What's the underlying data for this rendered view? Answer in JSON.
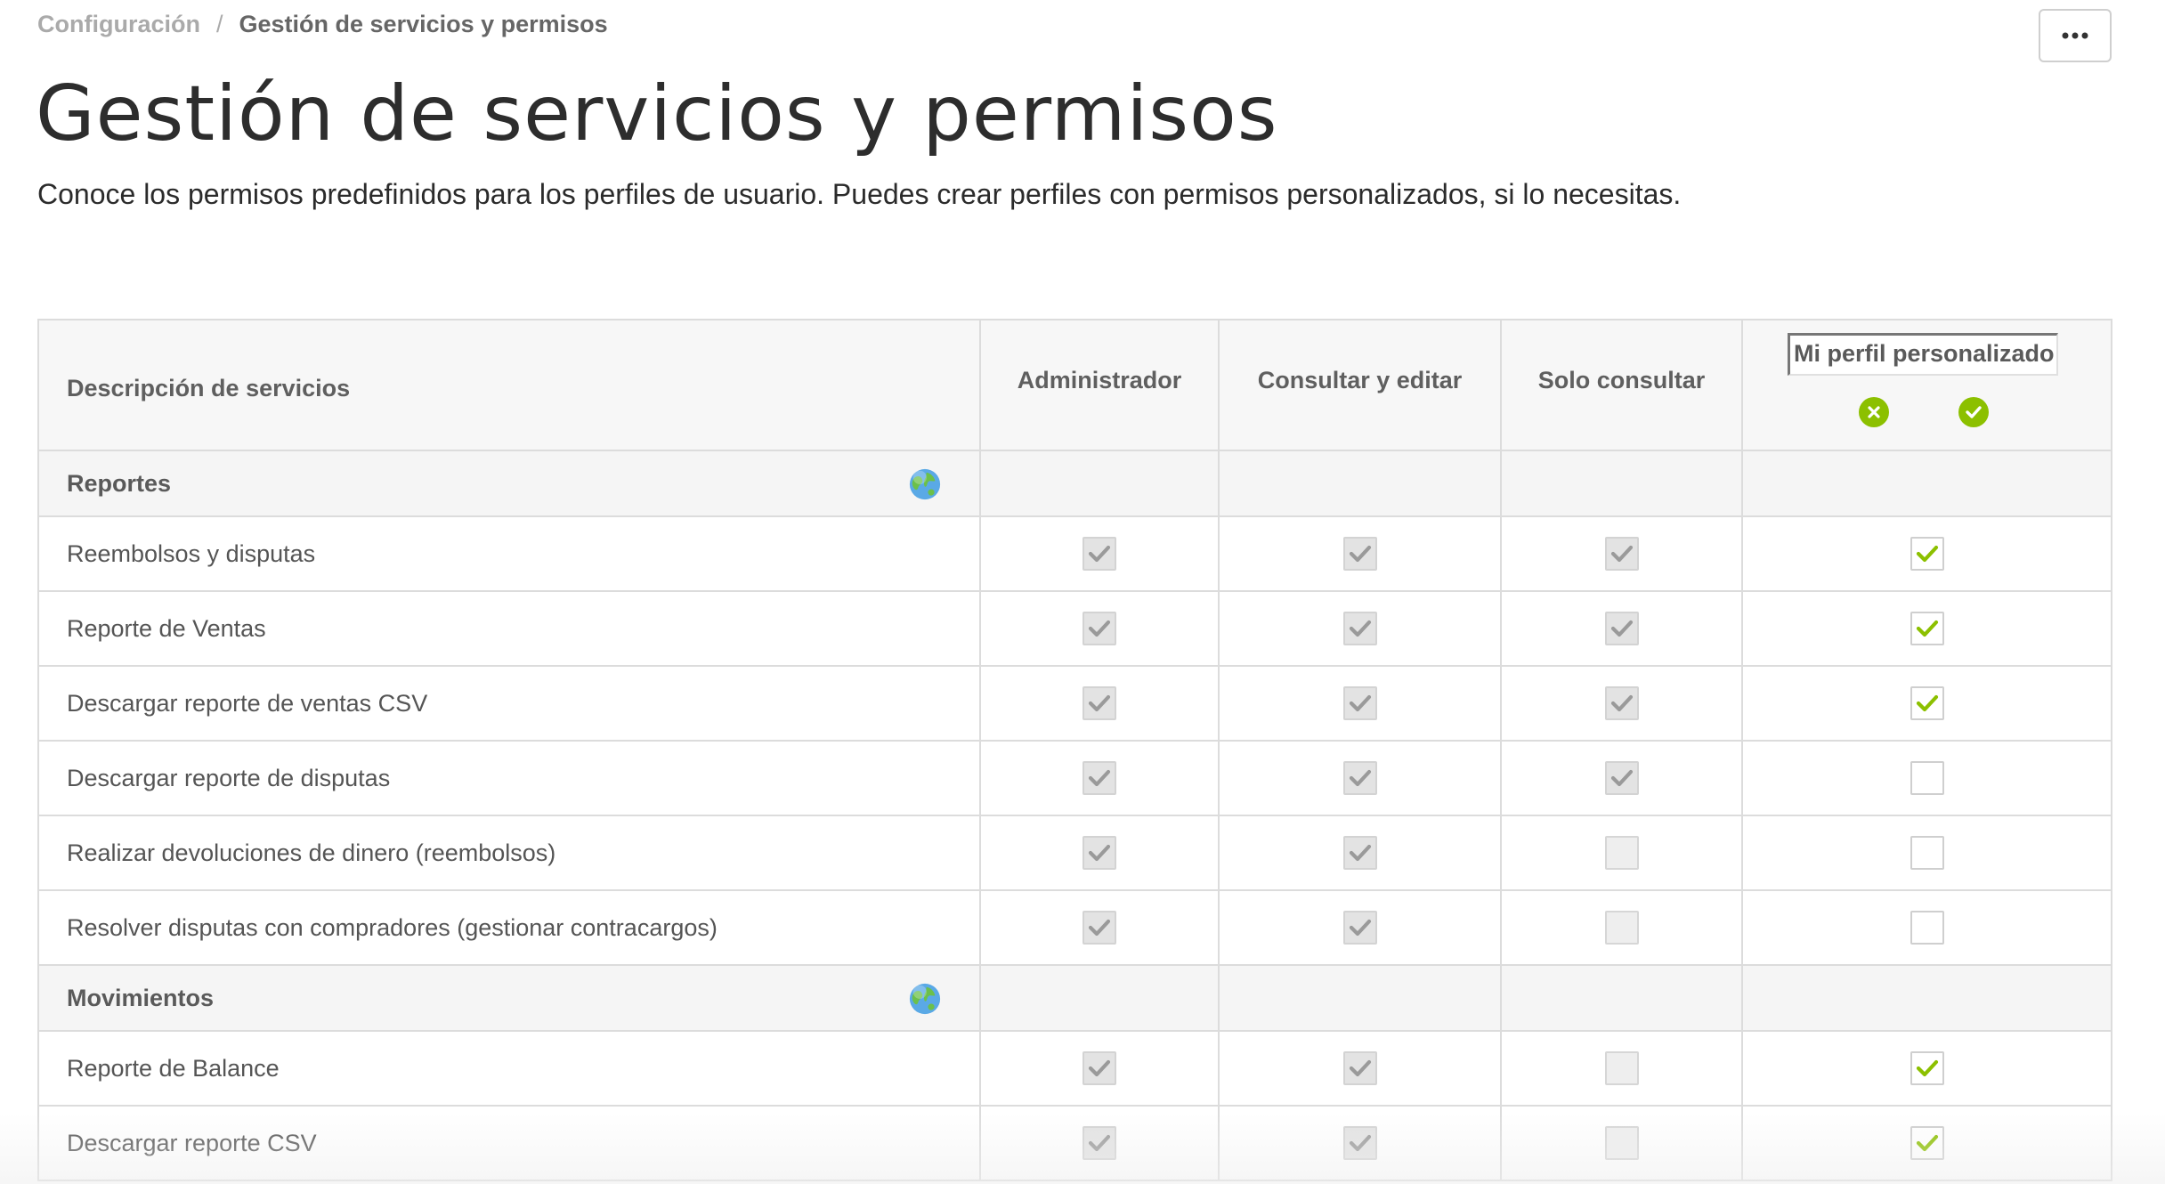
{
  "breadcrumb": {
    "root": "Configuración",
    "separator": "/",
    "current": "Gestión de servicios y permisos"
  },
  "more_button": {
    "icon": "more-horizontal-icon",
    "label": "•••"
  },
  "page": {
    "title": "Gestión de servicios y permisos",
    "subtitle": "Conoce los permisos predefinidos para los perfiles de usuario. Puedes crear perfiles con permisos personalizados, si lo necesitas."
  },
  "colors": {
    "accent_green": "#8cc000",
    "header_bg": "#f7f7f7",
    "border": "#dcdcdc",
    "checkbox_gray": "#e3e3e3"
  },
  "table": {
    "headers": {
      "description": "Descripción de servicios",
      "roles": [
        "Administrador",
        "Consultar y editar",
        "Solo consultar"
      ],
      "custom_profile": {
        "value": "Mi perfil personalizado",
        "cancel_icon": "cancel-circle-icon",
        "confirm_icon": "check-circle-icon"
      }
    },
    "sections": [
      {
        "name": "Reportes",
        "icon": "globe-icon",
        "rows": [
          {
            "label": "Reembolsos y disputas",
            "admin": true,
            "edit": true,
            "view": true,
            "custom": true
          },
          {
            "label": "Reporte de Ventas",
            "admin": true,
            "edit": true,
            "view": true,
            "custom": true
          },
          {
            "label": "Descargar reporte de ventas CSV",
            "admin": true,
            "edit": true,
            "view": true,
            "custom": true
          },
          {
            "label": "Descargar reporte de disputas",
            "admin": true,
            "edit": true,
            "view": true,
            "custom": false
          },
          {
            "label": "Realizar devoluciones de dinero (reembolsos)",
            "admin": true,
            "edit": true,
            "view": false,
            "custom": false
          },
          {
            "label": "Resolver disputas con compradores (gestionar contracargos)",
            "admin": true,
            "edit": true,
            "view": false,
            "custom": false
          }
        ]
      },
      {
        "name": "Movimientos",
        "icon": "globe-icon",
        "rows": [
          {
            "label": "Reporte de Balance",
            "admin": true,
            "edit": true,
            "view": false,
            "custom": true
          },
          {
            "label": "Descargar reporte CSV",
            "admin": true,
            "edit": true,
            "view": false,
            "custom": true
          }
        ]
      }
    ]
  }
}
